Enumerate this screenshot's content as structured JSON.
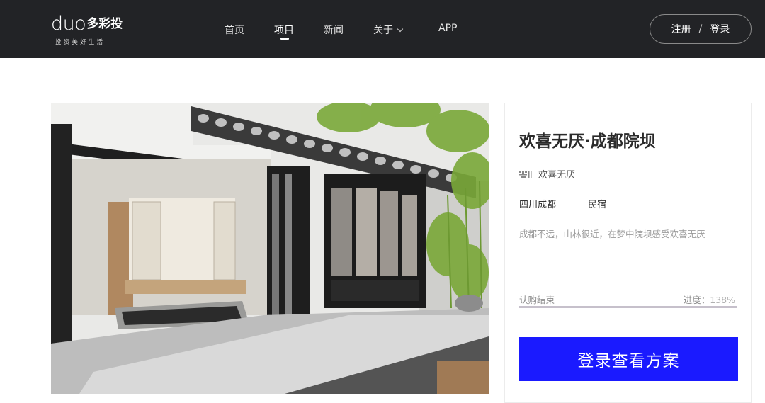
{
  "logo": {
    "latin": "duo",
    "cn": "多彩投",
    "tagline": "投资美好生活"
  },
  "nav": {
    "items": [
      {
        "label": "首页"
      },
      {
        "label": "项目"
      },
      {
        "label": "新闻"
      },
      {
        "label": "关于"
      },
      {
        "label": "APP"
      }
    ],
    "active": "项目"
  },
  "auth": {
    "register": "注册",
    "separator": "/",
    "login": "登录"
  },
  "project": {
    "title": "欢喜无厌·成都院坝",
    "brand": "欢喜无厌",
    "location": "四川成都",
    "category": "民宿",
    "description": "成都不远，山林很近，在梦中院坝感受欢喜无厌",
    "status": "认购结束",
    "progress_label": "进度：",
    "progress_value": "138%",
    "progress_fraction": 1.0,
    "cta": "登录查看方案"
  },
  "colors": {
    "topbar": "#222326",
    "cta": "#1a1aff",
    "progress": "#c6c0cb"
  }
}
